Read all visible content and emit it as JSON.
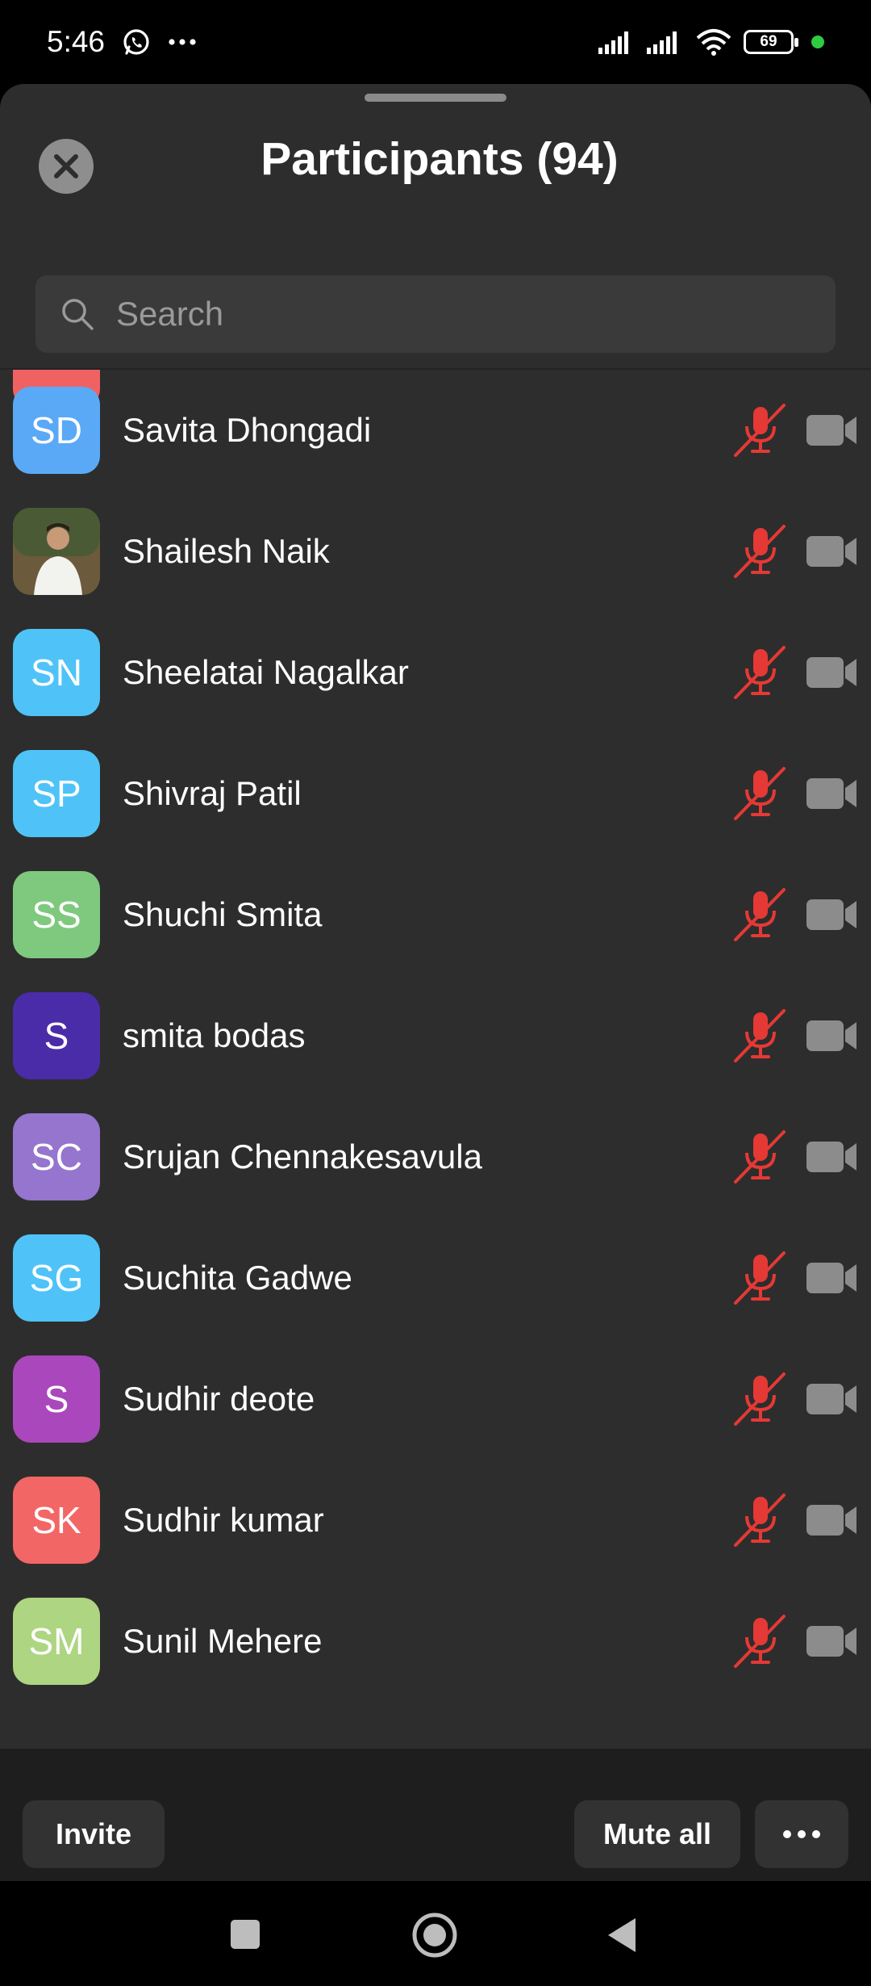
{
  "status_bar": {
    "time": "5:46",
    "battery": "69"
  },
  "header": {
    "title": "Participants (94)"
  },
  "search": {
    "placeholder": "Search"
  },
  "participants": [
    {
      "initials": "SD",
      "name": "Savita Dhongadi",
      "color": "#5aa9f6"
    },
    {
      "initials": "",
      "name": "Shailesh Naik",
      "color": "#6b5a3c"
    },
    {
      "initials": "SN",
      "name": "Sheelatai Nagalkar",
      "color": "#4fc3f7"
    },
    {
      "initials": "SP",
      "name": "Shivraj Patil",
      "color": "#4fc3f7"
    },
    {
      "initials": "SS",
      "name": "Shuchi Smita",
      "color": "#7ec97e"
    },
    {
      "initials": "S",
      "name": "smita bodas",
      "color": "#4a2ba8"
    },
    {
      "initials": "SC",
      "name": "Srujan Chennakesavula",
      "color": "#9575cd"
    },
    {
      "initials": "SG",
      "name": "Suchita Gadwe",
      "color": "#4fc3f7"
    },
    {
      "initials": "S",
      "name": "Sudhir deote",
      "color": "#ab47bc"
    },
    {
      "initials": "SK",
      "name": "Sudhir kumar",
      "color": "#f26666"
    },
    {
      "initials": "SM",
      "name": "Sunil Mehere",
      "color": "#aed581"
    }
  ],
  "footer": {
    "invite": "Invite",
    "mute_all": "Mute all"
  },
  "colors": {
    "mic_muted": "#e53935",
    "camera": "#8c8c8c",
    "sheet_bg": "#2d2d2d"
  }
}
